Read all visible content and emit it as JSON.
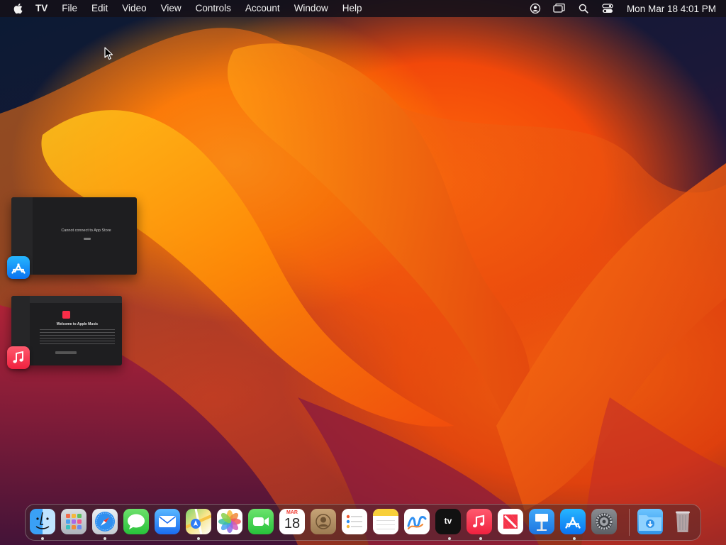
{
  "menubar": {
    "app_name": "TV",
    "menus": [
      "File",
      "Edit",
      "Video",
      "View",
      "Controls",
      "Account",
      "Window",
      "Help"
    ],
    "status_icons": [
      "user-account-icon",
      "screen-mirroring-icon",
      "spotlight-search-icon",
      "control-center-icon"
    ],
    "clock": "Mon Mar 18  4:01 PM"
  },
  "stage_manager": {
    "app_store_window": {
      "message": "Cannot connect to App Store"
    },
    "music_window": {
      "title": "Welcome to Apple Music"
    }
  },
  "dock": {
    "apps": [
      {
        "name": "Finder",
        "icon": "finder-icon",
        "running": true
      },
      {
        "name": "Launchpad",
        "icon": "launchpad-icon",
        "running": false
      },
      {
        "name": "Safari",
        "icon": "safari-icon",
        "running": true
      },
      {
        "name": "Messages",
        "icon": "messages-icon",
        "running": false
      },
      {
        "name": "Mail",
        "icon": "mail-icon",
        "running": false
      },
      {
        "name": "Maps",
        "icon": "maps-icon",
        "running": true
      },
      {
        "name": "Photos",
        "icon": "photos-icon",
        "running": false
      },
      {
        "name": "FaceTime",
        "icon": "facetime-icon",
        "running": false
      },
      {
        "name": "Calendar",
        "icon": "calendar-icon",
        "running": false
      },
      {
        "name": "Contacts",
        "icon": "contacts-icon",
        "running": false
      },
      {
        "name": "Reminders",
        "icon": "reminders-icon",
        "running": false
      },
      {
        "name": "Notes",
        "icon": "notes-icon",
        "running": false
      },
      {
        "name": "Freeform",
        "icon": "freeform-icon",
        "running": false
      },
      {
        "name": "TV",
        "icon": "tv-icon",
        "running": true
      },
      {
        "name": "Music",
        "icon": "music-icon",
        "running": true
      },
      {
        "name": "News",
        "icon": "news-icon",
        "running": false
      },
      {
        "name": "Keynote",
        "icon": "keynote-icon",
        "running": false
      },
      {
        "name": "App Store",
        "icon": "app-store-icon",
        "running": true
      },
      {
        "name": "System Settings",
        "icon": "system-settings-icon",
        "running": false
      }
    ],
    "calendar": {
      "month": "MAR",
      "day": "18"
    },
    "tv_label": "tv",
    "stacks": [
      {
        "name": "Downloads",
        "icon": "downloads-folder-icon"
      },
      {
        "name": "Trash",
        "icon": "trash-icon"
      }
    ]
  },
  "colors": {
    "accent_blue": "#0a72f0",
    "music_red": "#f0213f",
    "menubar_bg": "#141018"
  }
}
